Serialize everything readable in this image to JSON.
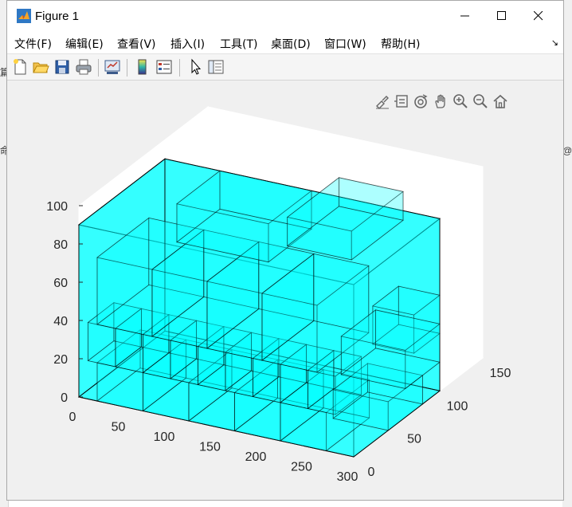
{
  "window": {
    "title": "Figure 1"
  },
  "menu": [
    {
      "label": "文件(F)"
    },
    {
      "label": "编辑(E)"
    },
    {
      "label": "查看(V)"
    },
    {
      "label": "插入(I)"
    },
    {
      "label": "工具(T)"
    },
    {
      "label": "桌面(D)"
    },
    {
      "label": "窗口(W)"
    },
    {
      "label": "帮助(H)"
    }
  ],
  "toolbar": {
    "icons": [
      "new-figure-icon",
      "open-file-icon",
      "save-icon",
      "print-icon",
      "link-plot-icon",
      "colorbar-icon",
      "legend-icon",
      "edit-plot-arrow-icon",
      "property-inspector-icon"
    ]
  },
  "axes_toolbar": {
    "icons": [
      "brush-icon",
      "data-tips-icon",
      "rotate-3d-icon",
      "pan-hand-icon",
      "zoom-in-icon",
      "zoom-out-icon",
      "restore-view-home-icon"
    ]
  },
  "background_glyphs": [
    "篇",
    "命",
    "@"
  ],
  "chart_data": {
    "type": "3d-box-packing",
    "face_color": "#00ffff",
    "edge_color": "#000000",
    "box_alpha": 0.35,
    "grid": true,
    "xlim": [
      0,
      300
    ],
    "ylim": [
      0,
      150
    ],
    "zlim": [
      0,
      100
    ],
    "x_ticks": [
      "0",
      "50",
      "100",
      "150",
      "200",
      "250",
      "300"
    ],
    "y_ticks": [
      "0",
      "50",
      "100",
      "150"
    ],
    "z_ticks": [
      "0",
      "20",
      "40",
      "60",
      "80",
      "100"
    ],
    "container": {
      "x": [
        0,
        300
      ],
      "y": [
        0,
        100
      ],
      "z": [
        0,
        100
      ]
    },
    "boxes": [
      {
        "x": [
          0,
          300
        ],
        "y": [
          0,
          100
        ],
        "z": [
          0,
          90
        ]
      },
      {
        "x": [
          20,
          70
        ],
        "y": [
          0,
          50
        ],
        "z": [
          0,
          20
        ]
      },
      {
        "x": [
          70,
          120
        ],
        "y": [
          0,
          50
        ],
        "z": [
          0,
          20
        ]
      },
      {
        "x": [
          120,
          170
        ],
        "y": [
          0,
          50
        ],
        "z": [
          0,
          20
        ]
      },
      {
        "x": [
          170,
          220
        ],
        "y": [
          0,
          50
        ],
        "z": [
          0,
          20
        ]
      },
      {
        "x": [
          220,
          270
        ],
        "y": [
          0,
          50
        ],
        "z": [
          0,
          20
        ]
      },
      {
        "x": [
          10,
          40
        ],
        "y": [
          0,
          30
        ],
        "z": [
          20,
          40
        ]
      },
      {
        "x": [
          40,
          70
        ],
        "y": [
          0,
          30
        ],
        "z": [
          20,
          40
        ]
      },
      {
        "x": [
          70,
          100
        ],
        "y": [
          0,
          30
        ],
        "z": [
          20,
          40
        ]
      },
      {
        "x": [
          100,
          130
        ],
        "y": [
          0,
          30
        ],
        "z": [
          20,
          40
        ]
      },
      {
        "x": [
          130,
          160
        ],
        "y": [
          0,
          30
        ],
        "z": [
          20,
          40
        ]
      },
      {
        "x": [
          160,
          190
        ],
        "y": [
          0,
          30
        ],
        "z": [
          20,
          40
        ]
      },
      {
        "x": [
          190,
          220
        ],
        "y": [
          0,
          30
        ],
        "z": [
          20,
          40
        ]
      },
      {
        "x": [
          220,
          250
        ],
        "y": [
          0,
          30
        ],
        "z": [
          20,
          40
        ]
      },
      {
        "x": [
          250,
          280
        ],
        "y": [
          0,
          30
        ],
        "z": [
          20,
          40
        ]
      },
      {
        "x": [
          20,
          80
        ],
        "y": [
          0,
          60
        ],
        "z": [
          40,
          75
        ]
      },
      {
        "x": [
          80,
          140
        ],
        "y": [
          0,
          60
        ],
        "z": [
          40,
          75
        ]
      },
      {
        "x": [
          140,
          200
        ],
        "y": [
          0,
          60
        ],
        "z": [
          40,
          75
        ]
      },
      {
        "x": [
          200,
          260
        ],
        "y": [
          0,
          60
        ],
        "z": [
          40,
          75
        ]
      },
      {
        "x": [
          60,
          160
        ],
        "y": [
          50,
          100
        ],
        "z": [
          70,
          90
        ]
      },
      {
        "x": [
          190,
          260
        ],
        "y": [
          40,
          100
        ],
        "z": [
          85,
          100
        ]
      },
      {
        "x": [
          240,
          300
        ],
        "y": [
          40,
          80
        ],
        "z": [
          0,
          15
        ]
      },
      {
        "x": [
          255,
          300
        ],
        "y": [
          70,
          100
        ],
        "z": [
          30,
          50
        ]
      },
      {
        "x": [
          230,
          300
        ],
        "y": [
          60,
          100
        ],
        "z": [
          15,
          35
        ]
      }
    ]
  }
}
